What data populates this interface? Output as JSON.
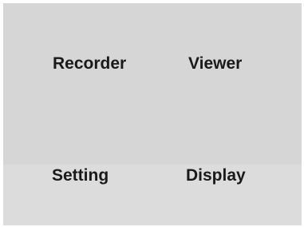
{
  "menu": {
    "recorder_label": "Recorder",
    "viewer_label": "Viewer",
    "setting_label": "Setting",
    "display_label": "Display"
  },
  "colors": {
    "background": "#d6d6d6",
    "text": "#1a1a1a"
  }
}
